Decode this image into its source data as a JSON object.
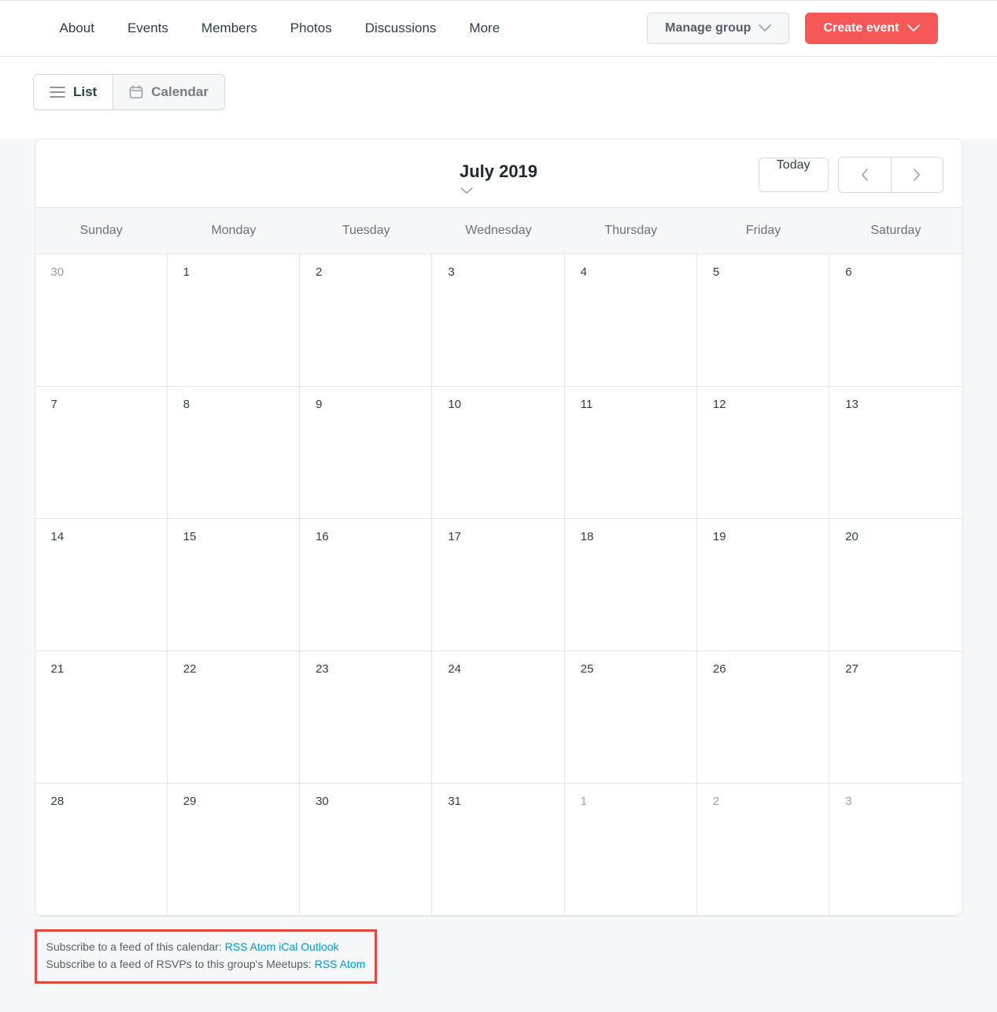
{
  "nav": {
    "items": [
      "About",
      "Events",
      "Members",
      "Photos",
      "Discussions",
      "More"
    ]
  },
  "actions": {
    "manage_label": "Manage group",
    "create_label": "Create event"
  },
  "view_toggle": {
    "list_label": "List",
    "calendar_label": "Calendar"
  },
  "calendar": {
    "title": "July 2019",
    "today_label": "Today",
    "dow": [
      "Sunday",
      "Monday",
      "Tuesday",
      "Wednesday",
      "Thursday",
      "Friday",
      "Saturday"
    ],
    "weeks": [
      [
        {
          "d": "30",
          "other": true
        },
        {
          "d": "1"
        },
        {
          "d": "2"
        },
        {
          "d": "3"
        },
        {
          "d": "4"
        },
        {
          "d": "5"
        },
        {
          "d": "6"
        }
      ],
      [
        {
          "d": "7"
        },
        {
          "d": "8"
        },
        {
          "d": "9"
        },
        {
          "d": "10"
        },
        {
          "d": "11"
        },
        {
          "d": "12"
        },
        {
          "d": "13"
        }
      ],
      [
        {
          "d": "14"
        },
        {
          "d": "15"
        },
        {
          "d": "16"
        },
        {
          "d": "17"
        },
        {
          "d": "18"
        },
        {
          "d": "19"
        },
        {
          "d": "20"
        }
      ],
      [
        {
          "d": "21"
        },
        {
          "d": "22"
        },
        {
          "d": "23"
        },
        {
          "d": "24"
        },
        {
          "d": "25"
        },
        {
          "d": "26"
        },
        {
          "d": "27"
        }
      ],
      [
        {
          "d": "28"
        },
        {
          "d": "29"
        },
        {
          "d": "30"
        },
        {
          "d": "31"
        },
        {
          "d": "1",
          "other": true
        },
        {
          "d": "2",
          "other": true
        },
        {
          "d": "3",
          "other": true
        }
      ]
    ]
  },
  "feeds": {
    "line1_prefix": "Subscribe to a feed of this calendar: ",
    "line1_links": [
      "RSS",
      "Atom",
      "iCal",
      "Outlook"
    ],
    "line2_prefix": "Subscribe to a feed of RSVPs to this group's Meetups: ",
    "line2_links": [
      "RSS",
      "Atom"
    ]
  }
}
